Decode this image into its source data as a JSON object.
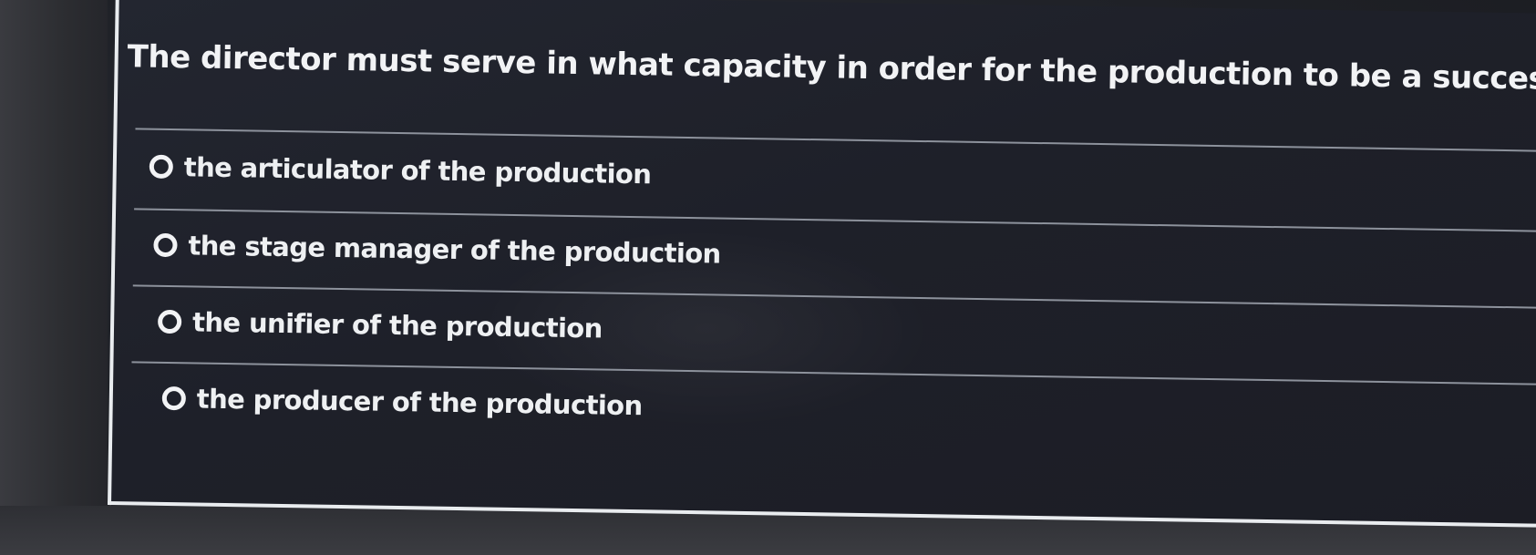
{
  "question": {
    "text": "The director must serve in what capacity in order for the production to be a success."
  },
  "options": [
    {
      "label": "the articulator of the production",
      "selected": false
    },
    {
      "label": "the stage manager of the production",
      "selected": false
    },
    {
      "label": "the unifier of the production",
      "selected": false
    },
    {
      "label": "the producer of the production",
      "selected": false
    }
  ],
  "colors": {
    "card_background": "#1e2029",
    "text": "#f2f3f5",
    "divider": "#8d929c",
    "border": "#e9ecef"
  }
}
